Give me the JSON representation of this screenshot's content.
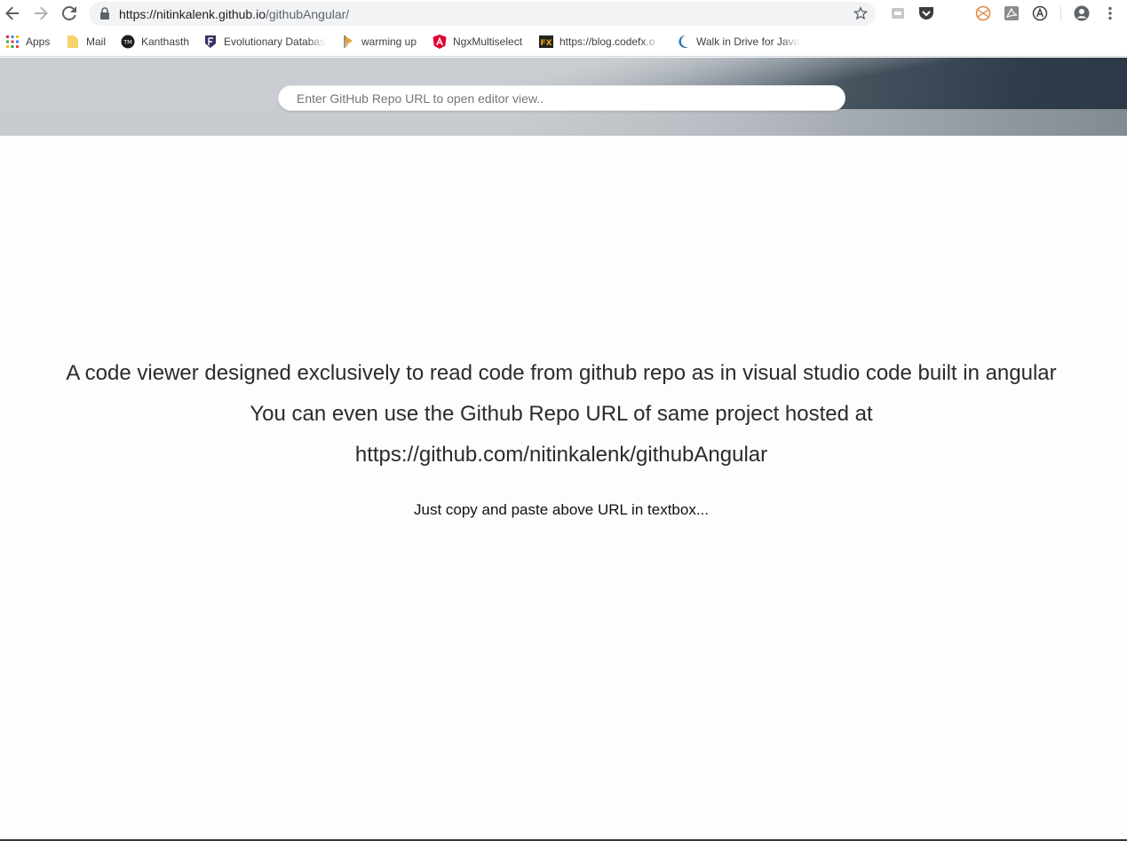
{
  "browser": {
    "url_host": "https://nitinkalenk.github.io",
    "url_path": "/githubAngular/",
    "bookmarks": [
      {
        "label": "Apps",
        "icon": "apps-grid-icon"
      },
      {
        "label": "Mail",
        "icon": "folder-icon"
      },
      {
        "label": "Kanthasth",
        "icon": "tm-logo-icon"
      },
      {
        "label": "Evolutionary Databas",
        "icon": "shield-f-icon"
      },
      {
        "label": "warming up",
        "icon": "pen-icon"
      },
      {
        "label": "NgxMultiselect",
        "icon": "angular-icon"
      },
      {
        "label": "https://blog.codefx.o",
        "icon": "fx-icon"
      },
      {
        "label": "Walk in Drive for Java",
        "icon": "moon-icon"
      }
    ]
  },
  "header": {
    "search_placeholder": "Enter GitHub Repo URL to open editor view.."
  },
  "main": {
    "line1": "A code viewer designed exclusively to read code from github repo as in visual studio code built in angular",
    "line2": "You can even use the Github Repo URL of same project hosted at",
    "line3": "https://github.com/nitinkalenk/githubAngular",
    "hint": "Just copy and paste above URL in textbox..."
  },
  "colors": {
    "header_dark": "#2c3a48",
    "header_light": "#c8ccd0",
    "text": "#2b2b2b"
  }
}
